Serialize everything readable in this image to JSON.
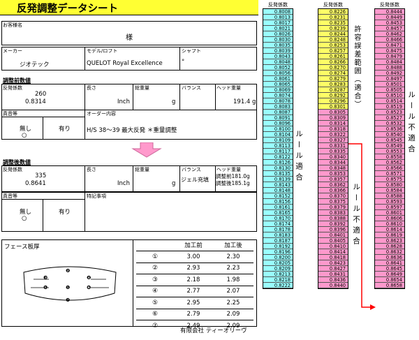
{
  "title": "反発調整データシート",
  "customer": {
    "label": "お客様名",
    "honorific": "様"
  },
  "maker": {
    "label": "メーカー",
    "value": "ジオテック"
  },
  "model": {
    "label": "モデル/ロフト",
    "value": "QUELOT  Royal Excellence"
  },
  "shaft": {
    "label": "シャフト",
    "value": "°"
  },
  "before": {
    "section": "調整前数値",
    "coef_label": "反発係数",
    "coef_raw": "260",
    "coef": "0.8314",
    "length_label": "長さ",
    "length_unit": "Inch",
    "weight_label": "総重量",
    "weight_unit": "g",
    "balance_label": "バランス",
    "head_label": "ヘッド重量",
    "head_value": "191.4 g",
    "faceon_label": "真音等",
    "nashi": "無し",
    "circle": "○",
    "ari": "有り",
    "order_label": "オーダー内容",
    "order_text": "H/S  38〜39    最大反発   ＊重量調整"
  },
  "after": {
    "section": "調整後数値",
    "coef_label": "反発係数",
    "coef_raw": "335",
    "coef": "0.8641",
    "length_label": "長さ",
    "length_unit": "Inch",
    "weight_label": "総重量",
    "weight_unit": "g",
    "balance_label": "バランス",
    "balance_value": "ジェル充填",
    "head_label": "ヘッド重量",
    "head_before": "調整前181.0g",
    "head_after": "調整後185.1g",
    "faceon_label": "真音等",
    "nashi": "無し",
    "circle": "○",
    "ari": "有り",
    "special_label": "特記事項"
  },
  "face": {
    "label": "フェース板厚",
    "col_before": "加工前",
    "col_after": "加工後",
    "rows": [
      {
        "n": "①",
        "b": "3.00",
        "a": "2.30"
      },
      {
        "n": "②",
        "b": "2.93",
        "a": "2.23"
      },
      {
        "n": "③",
        "b": "2.18",
        "a": "1.98"
      },
      {
        "n": "④",
        "b": "2.77",
        "a": "2.07"
      },
      {
        "n": "⑤",
        "b": "2.95",
        "a": "2.25"
      },
      {
        "n": "⑥",
        "b": "2.79",
        "a": "2.09"
      },
      {
        "n": "⑦",
        "b": "2.49",
        "a": "2.09"
      }
    ],
    "diagram": [
      "❷",
      "❸",
      "❶",
      "❹",
      "❺",
      "❻",
      "❼"
    ],
    "company": "有限会社  ティーオリーヴ"
  },
  "columns": {
    "header": "反発係数",
    "c1": [
      "0.8008",
      "0.8013",
      "0.8017",
      "0.8021",
      "0.8026",
      "0.8030",
      "0.8035",
      "0.8039",
      "0.8043",
      "0.8048",
      "0.8052",
      "0.8056",
      "0.8061",
      "0.8065",
      "0.8069",
      "0.8074",
      "0.8078",
      "0.8083",
      "0.8087",
      "0.8091",
      "0.8096",
      "0.8100",
      "0.8104",
      "0.8109",
      "0.8113",
      "0.8117",
      "0.8122",
      "0.8126",
      "0.8130",
      "0.8135",
      "0.8139",
      "0.8143",
      "0.8148",
      "0.8152",
      "0.8156",
      "0.8161",
      "0.8165",
      "0.8170",
      "0.8174",
      "0.8178",
      "0.8183",
      "0.8187",
      "0.8192",
      "0.8196",
      "0.8200",
      "0.8205",
      "0.8209",
      "0.8213",
      "0.8218",
      "0.8222"
    ],
    "c2": [
      "0.8226",
      "0.8231",
      "0.8235",
      "0.8239",
      "0.8244",
      "0.8248",
      "0.8253",
      "0.8257",
      "0.8261",
      "0.8266",
      "0.8270",
      "0.8274",
      "0.8279",
      "0.8283",
      "0.8287",
      "0.8292",
      "0.8296",
      "0.8301",
      "0.8305",
      "0.8309",
      "0.8314",
      "0.8318",
      "0.8322",
      "0.8327",
      "0.8331",
      "0.8335",
      "0.8340",
      "0.8344",
      "0.8348",
      "0.8353",
      "0.8357",
      "0.8362",
      "0.8366",
      "0.8370",
      "0.8375",
      "0.8379",
      "0.8383",
      "0.8388",
      "0.8392",
      "0.8396",
      "0.8401",
      "0.8405",
      "0.8410",
      "0.8414",
      "0.8418",
      "0.8423",
      "0.8427",
      "0.8431",
      "0.8436",
      "0.8440"
    ],
    "c3": [
      "0.8444",
      "0.8449",
      "0.8453",
      "0.8457",
      "0.8462",
      "0.8466",
      "0.8471",
      "0.8475",
      "0.8479",
      "0.8484",
      "0.8488",
      "0.8492",
      "0.8497",
      "0.8501",
      "0.8505",
      "0.8510",
      "0.8514",
      "0.8519",
      "0.8523",
      "0.8527",
      "0.8532",
      "0.8536",
      "0.8540",
      "0.8545",
      "0.8549",
      "0.8553",
      "0.8558",
      "0.8562",
      "0.8566",
      "0.8571",
      "0.8575",
      "0.8580",
      "0.8584",
      "0.8588",
      "0.8593",
      "0.8597",
      "0.8601",
      "0.8606",
      "0.8610",
      "0.8614",
      "0.8619",
      "0.8623",
      "0.8628",
      "0.8632",
      "0.8636",
      "0.8641",
      "0.8645",
      "0.8649",
      "0.8654",
      "0.8658"
    ],
    "c2_yellow_count": 18,
    "c1_rule_text": "ルール適合",
    "c2_allow_text": "許容誤差範囲（適合）",
    "c2_rule_text": "ルール不適合",
    "c3_rule_text": "ルール不適合",
    "colors": {
      "cyan": "#99ffff",
      "yellow": "#ffff66",
      "pink": "#ff99cc",
      "arrow": "#ff0000",
      "arrow_down": "#ff99cc"
    }
  }
}
